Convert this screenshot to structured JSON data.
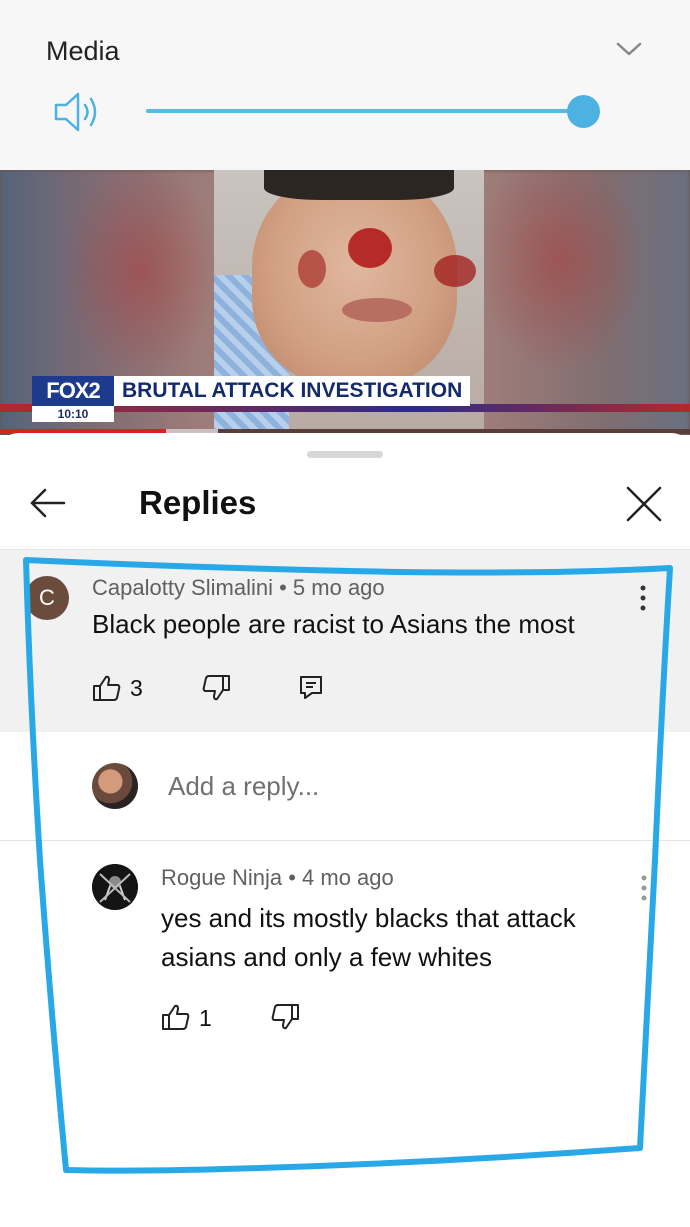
{
  "media_panel": {
    "title": "Media",
    "volume_level": 1.0,
    "accent_color": "#4db2e2"
  },
  "video": {
    "channel_logo": "FOX2",
    "channel_time": "10:10",
    "headline": "BRUTAL ATTACK INVESTIGATION",
    "progress_fraction": 0.24
  },
  "replies_sheet": {
    "title": "Replies",
    "parent_comment": {
      "avatar_letter": "C",
      "author": "Capalotty Slimalini",
      "separator": "•",
      "age": "5 mo ago",
      "text": "Black people are racist to Asians the most",
      "likes": "3"
    },
    "reply_input": {
      "placeholder": "Add a reply..."
    },
    "replies": [
      {
        "author": "Rogue Ninja",
        "separator": "•",
        "age": "4 mo ago",
        "text": "yes and its mostly blacks that attack asians and only a few whites",
        "likes": "1"
      }
    ]
  },
  "annotation": {
    "stroke_color": "#29a8e8"
  }
}
